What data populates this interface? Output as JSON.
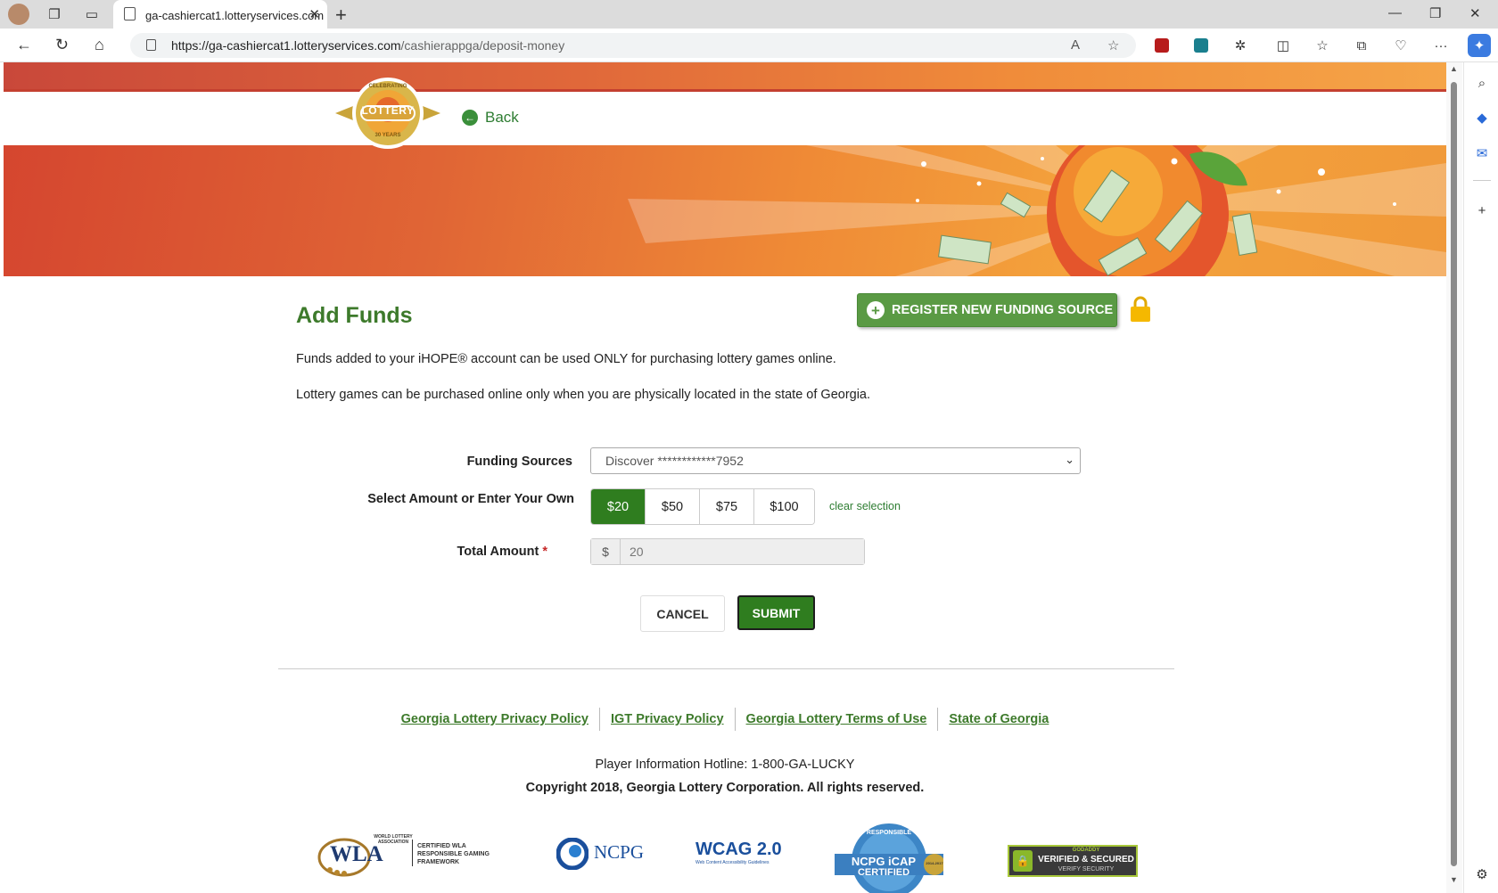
{
  "browser": {
    "tab_title": "ga-cashiercat1.lotteryservices.com",
    "url_host": "https://ga-cashiercat1.lotteryservices.com",
    "url_path": "/cashierappga/deposit-money"
  },
  "header": {
    "logo_text": "LOTTERY",
    "logo_ring_top": "CELEBRATING",
    "logo_ring_bottom": "30 YEARS",
    "back_label": "Back"
  },
  "form": {
    "title": "Add Funds",
    "register_label": "REGISTER NEW FUNDING SOURCE",
    "intro1": "Funds added to your iHOPE® account can be used ONLY for purchasing lottery games online.",
    "intro2": "Lottery games can be purchased online only when you are physically located in the state of Georgia.",
    "funding_label": "Funding Sources",
    "funding_value": "Discover ************7952",
    "amount_label": "Select Amount or Enter Your Own",
    "amounts": [
      "$20",
      "$50",
      "$75",
      "$100"
    ],
    "selected_amount": "$20",
    "clear_label": "clear selection",
    "total_label": "Total Amount",
    "required_mark": "*",
    "currency": "$",
    "total_value": "20",
    "cancel_label": "CANCEL",
    "submit_label": "SUBMIT"
  },
  "footer": {
    "links": [
      "Georgia Lottery Privacy Policy",
      "IGT Privacy Policy",
      "Georgia Lottery Terms of Use",
      "State of Georgia"
    ],
    "hotline": "Player Information Hotline: 1-800-GA-LUCKY",
    "copyright": "Copyright 2018, Georgia Lottery Corporation. All rights reserved.",
    "badges": {
      "wla": "WLA",
      "wla_top": "WORLD LOTTERY ASSOCIATION",
      "wla_text": "CERTIFIED WLA RESPONSIBLE GAMING FRAMEWORK",
      "ncpg": "NCPG",
      "wcag": "WCAG 2.0",
      "wcag_sub": "Web Content Accessibility Guidelines",
      "icap_top": "RESPONSIBLE",
      "icap": "NCPG iCAP",
      "icap_sub": "CERTIFIED",
      "icap_years": "2014-2017",
      "godaddy_top": "GODADDY",
      "godaddy": "VERIFIED & SECURED",
      "godaddy_sub": "VERIFY SECURITY"
    }
  }
}
